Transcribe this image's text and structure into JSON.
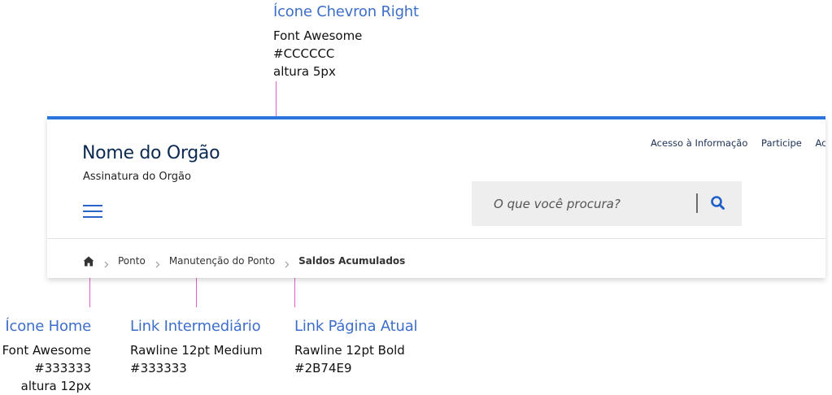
{
  "annotations": {
    "chevron": {
      "title": "Ícone Chevron Right",
      "lines": [
        "Font Awesome",
        "#CCCCCC",
        "altura 5px"
      ]
    },
    "home": {
      "title": "Ícone Home",
      "lines": [
        "Font Awesome",
        "#333333",
        "altura 12px"
      ]
    },
    "link": {
      "title": "Link Intermediário",
      "lines": [
        "Rawline 12pt Medium",
        "#333333"
      ]
    },
    "current": {
      "title": "Link Página Atual",
      "lines": [
        "Rawline 12pt Bold",
        "#2B74E9"
      ]
    }
  },
  "header": {
    "org_name": "Nome do Orgão",
    "org_signature": "Assinatura do Orgão",
    "top_links": [
      "Acesso à Informação",
      "Participe",
      "Ac"
    ],
    "search": {
      "placeholder": "O que você procura?"
    },
    "breadcrumb": {
      "links": [
        "Ponto",
        "Manutenção do Ponto"
      ],
      "current": "Saldos Acumulados"
    }
  },
  "colors": {
    "accent": "#2B74E9",
    "leader": "#E060C8",
    "chevron": "#CCCCCC",
    "text": "#333333"
  },
  "icons": [
    "home-icon",
    "chevron-right-icon",
    "search-icon",
    "hamburger-menu-icon"
  ]
}
